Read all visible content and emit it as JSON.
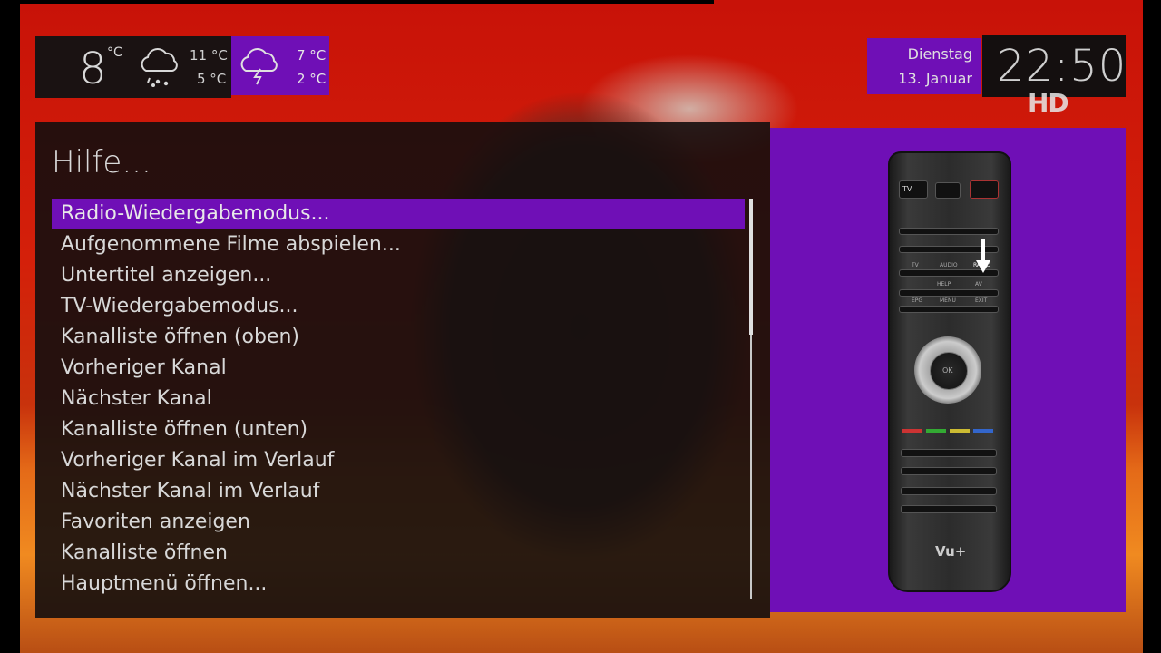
{
  "weather": {
    "current_temp": "8",
    "current_unit": "°C",
    "today_high": "11 °C",
    "today_low": "5 °C",
    "today_icon": "rain-cloud-icon",
    "tomorrow_high": "7 °C",
    "tomorrow_low": "2 °C",
    "tomorrow_icon": "thunderstorm-cloud-icon"
  },
  "datetime": {
    "weekday": "Dienstag",
    "date": "13. Januar",
    "time": "22:50"
  },
  "channel_badge": "HD",
  "menu": {
    "title": "Hilfe...",
    "items": [
      "Radio-Wiedergabemodus...",
      "Aufgenommene Filme abspielen...",
      "Untertitel anzeigen...",
      "TV-Wiedergabemodus...",
      "Kanalliste öffnen (oben)",
      "Vorheriger Kanal",
      "Nächster Kanal",
      "Kanalliste öffnen (unten)",
      "Vorheriger Kanal im Verlauf",
      "Nächster Kanal im Verlauf",
      "Favoriten anzeigen",
      "Kanalliste öffnen",
      "Hauptmenü öffnen..."
    ],
    "selected_index": 0
  },
  "remote": {
    "brand": "Vu+",
    "labels": [
      "TV",
      "AUDIO",
      "RADIO",
      "HELP",
      "AV",
      "EPG",
      "MENU",
      "EXIT",
      "OK"
    ],
    "highlighted_button": "RADIO"
  },
  "colors": {
    "accent": "#6f0fb6",
    "panel": "#140f0f"
  }
}
